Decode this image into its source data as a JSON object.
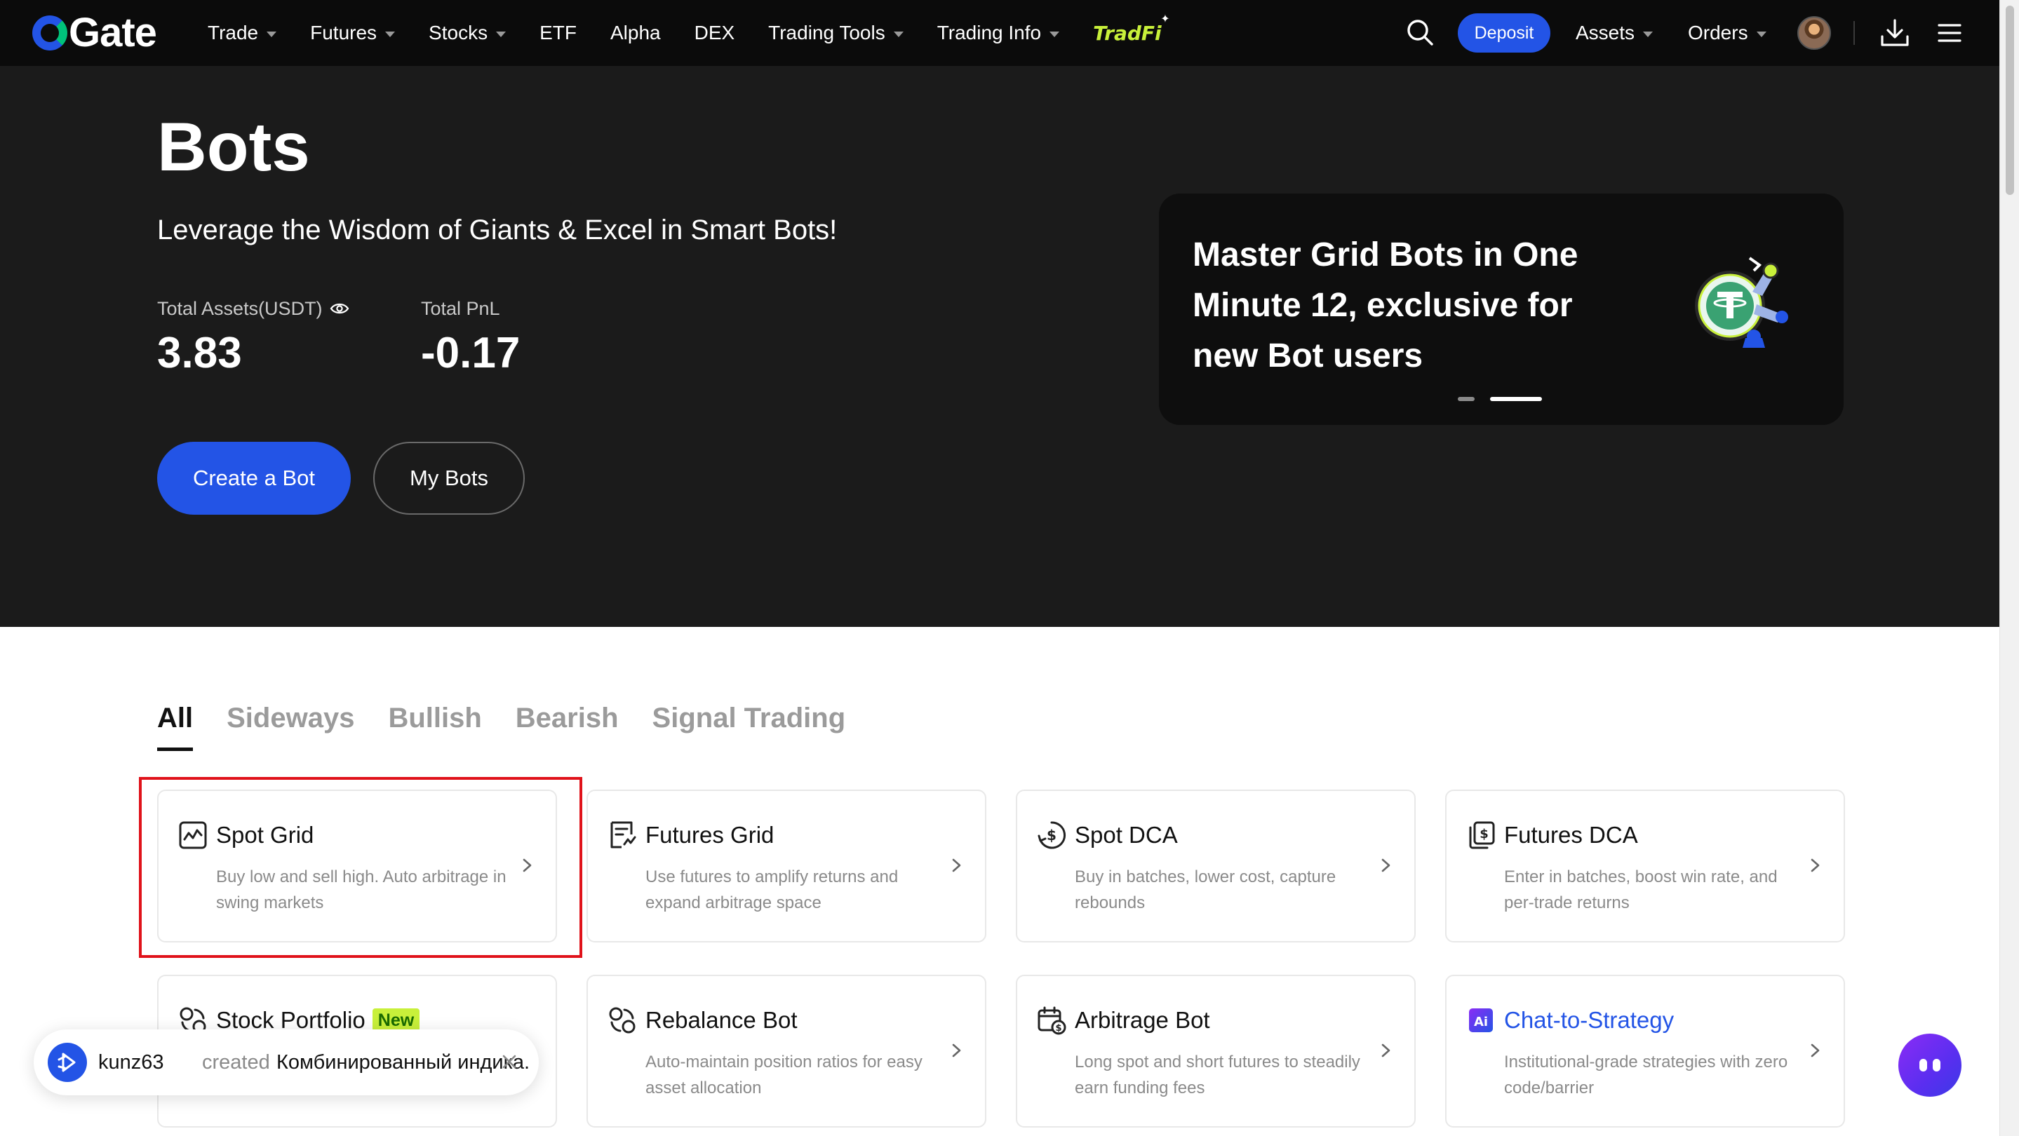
{
  "nav": {
    "logo_text": "Gate",
    "items": [
      {
        "label": "Trade",
        "has_caret": true
      },
      {
        "label": "Futures",
        "has_caret": true
      },
      {
        "label": "Stocks",
        "has_caret": true
      },
      {
        "label": "ETF",
        "has_caret": false
      },
      {
        "label": "Alpha",
        "has_caret": false
      },
      {
        "label": "DEX",
        "has_caret": false
      },
      {
        "label": "Trading Tools",
        "has_caret": true
      },
      {
        "label": "Trading Info",
        "has_caret": true
      }
    ],
    "tradfi_label": "TradFi",
    "deposit_label": "Deposit",
    "assets_label": "Assets",
    "orders_label": "Orders"
  },
  "hero": {
    "title": "Bots",
    "subtitle": "Leverage the Wisdom of Giants & Excel in Smart Bots!",
    "total_assets_label": "Total Assets(USDT)",
    "total_assets_value": "3.83",
    "total_pnl_label": "Total PnL",
    "total_pnl_value": "-0.17",
    "create_bot_label": "Create a Bot",
    "my_bots_label": "My Bots",
    "promo_text": "Master Grid Bots in One Minute 12, exclusive for new Bot users",
    "carousel_active_index": 1,
    "carousel_count": 2
  },
  "tabs": [
    {
      "label": "All",
      "active": true
    },
    {
      "label": "Sideways",
      "active": false
    },
    {
      "label": "Bullish",
      "active": false
    },
    {
      "label": "Bearish",
      "active": false
    },
    {
      "label": "Signal Trading",
      "active": false
    }
  ],
  "cards": [
    {
      "title": "Spot Grid",
      "desc": "Buy low and sell high. Auto arbitrage in swing markets",
      "icon": "spot-grid-icon",
      "highlighted": true
    },
    {
      "title": "Futures Grid",
      "desc": "Use futures to amplify returns and expand arbitrage space",
      "icon": "futures-grid-icon"
    },
    {
      "title": "Spot DCA",
      "desc": "Buy in batches, lower cost, capture rebounds",
      "icon": "dollar-cycle-icon"
    },
    {
      "title": "Futures DCA",
      "desc": "Enter in batches, boost win rate, and per-trade returns",
      "icon": "futures-dca-icon"
    },
    {
      "title": "Stock Portfolio",
      "badge": "New",
      "desc": "",
      "icon": "stock-portfolio-icon"
    },
    {
      "title": "Rebalance Bot",
      "desc": "Auto-maintain position ratios for easy asset allocation",
      "icon": "rebalance-icon"
    },
    {
      "title": "Arbitrage Bot",
      "desc": "Long spot and short futures to steadily earn funding fees",
      "icon": "arbitrage-calendar-icon"
    },
    {
      "title": "Chat-to-Strategy",
      "desc": "Institutional-grade strategies with zero code/barrier",
      "icon": "ai-icon"
    }
  ],
  "toast": {
    "user": "kunz63",
    "action": "created",
    "item": "Комбинированный индика..."
  },
  "colors": {
    "brand_blue": "#2354e6",
    "hero_bg": "#1b1b1b",
    "nav_bg": "#0b0b0b",
    "tradfi_green": "#c8f03a",
    "highlight_red": "#e0121a"
  }
}
